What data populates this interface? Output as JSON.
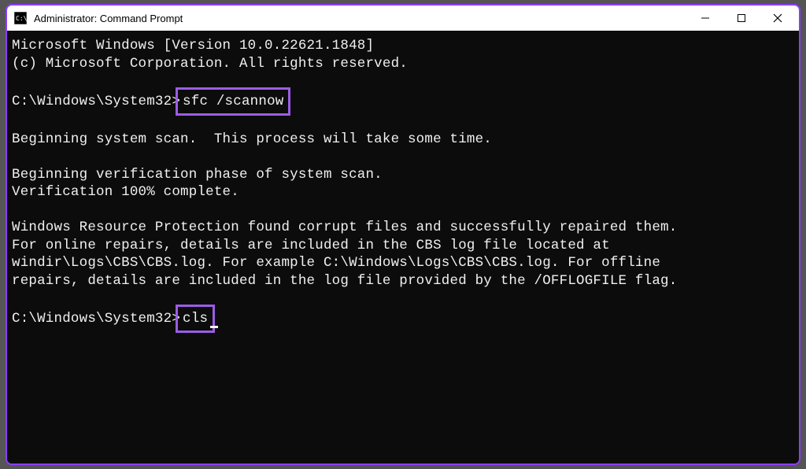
{
  "window": {
    "title": "Administrator: Command Prompt"
  },
  "terminal": {
    "header_line1": "Microsoft Windows [Version 10.0.22621.1848]",
    "header_line2": "(c) Microsoft Corporation. All rights reserved.",
    "prompt1_prefix": "C:\\Windows\\System32>",
    "prompt1_cmd": "sfc /scannow",
    "output_line1": "Beginning system scan.  This process will take some time.",
    "output_line2": "Beginning verification phase of system scan.",
    "output_line3": "Verification 100% complete.",
    "output_line4": "Windows Resource Protection found corrupt files and successfully repaired them.",
    "output_line5": "For online repairs, details are included in the CBS log file located at",
    "output_line6": "windir\\Logs\\CBS\\CBS.log. For example C:\\Windows\\Logs\\CBS\\CBS.log. For offline",
    "output_line7": "repairs, details are included in the log file provided by the /OFFLOGFILE flag.",
    "prompt2_prefix": "C:\\Windows\\System32>",
    "prompt2_cmd": "cls"
  },
  "annotations": {
    "highlight1": "sfc /scannow",
    "highlight2": "cls"
  }
}
